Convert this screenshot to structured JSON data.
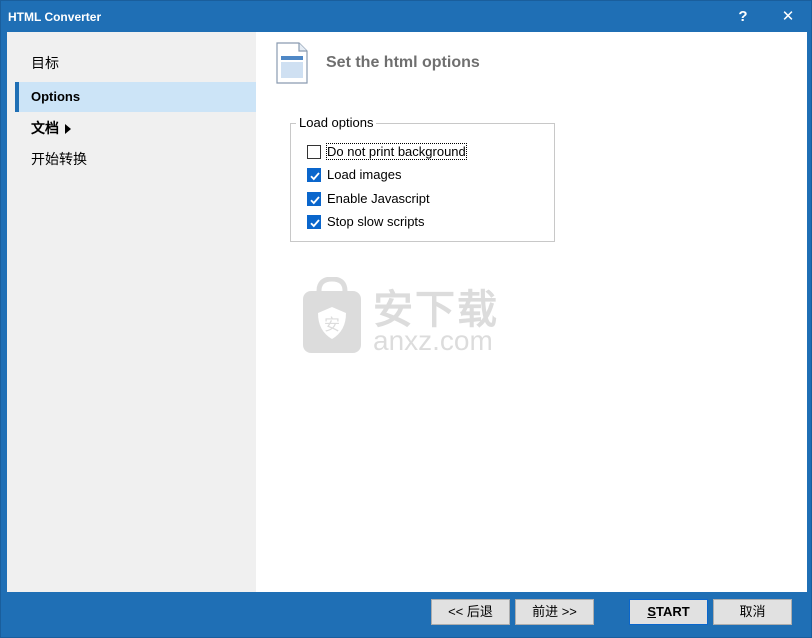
{
  "window": {
    "title": "HTML Converter",
    "help_label": "?",
    "close_label": "✕"
  },
  "sidebar": {
    "items": [
      {
        "label": "目标"
      },
      {
        "label": "Options"
      },
      {
        "label": "文档"
      },
      {
        "label": "开始转换"
      }
    ]
  },
  "main": {
    "title": "Set the html options",
    "group": {
      "legend": "Load options",
      "options": [
        {
          "label": "Do not print background",
          "checked": false
        },
        {
          "label": "Load images",
          "checked": true
        },
        {
          "label": "Enable Javascript",
          "checked": true
        },
        {
          "label": "Stop slow scripts",
          "checked": true
        }
      ]
    }
  },
  "watermark": {
    "cn": "安下载",
    "en": "anxz.com"
  },
  "footer": {
    "back_label": "<< 后退",
    "next_label": "前进 >>",
    "start_first": "S",
    "start_rest": "TART",
    "cancel_label": "取消"
  },
  "colors": {
    "accent": "#1f6fb5",
    "selection": "#cce4f7",
    "checkbox": "#0a66cc"
  }
}
